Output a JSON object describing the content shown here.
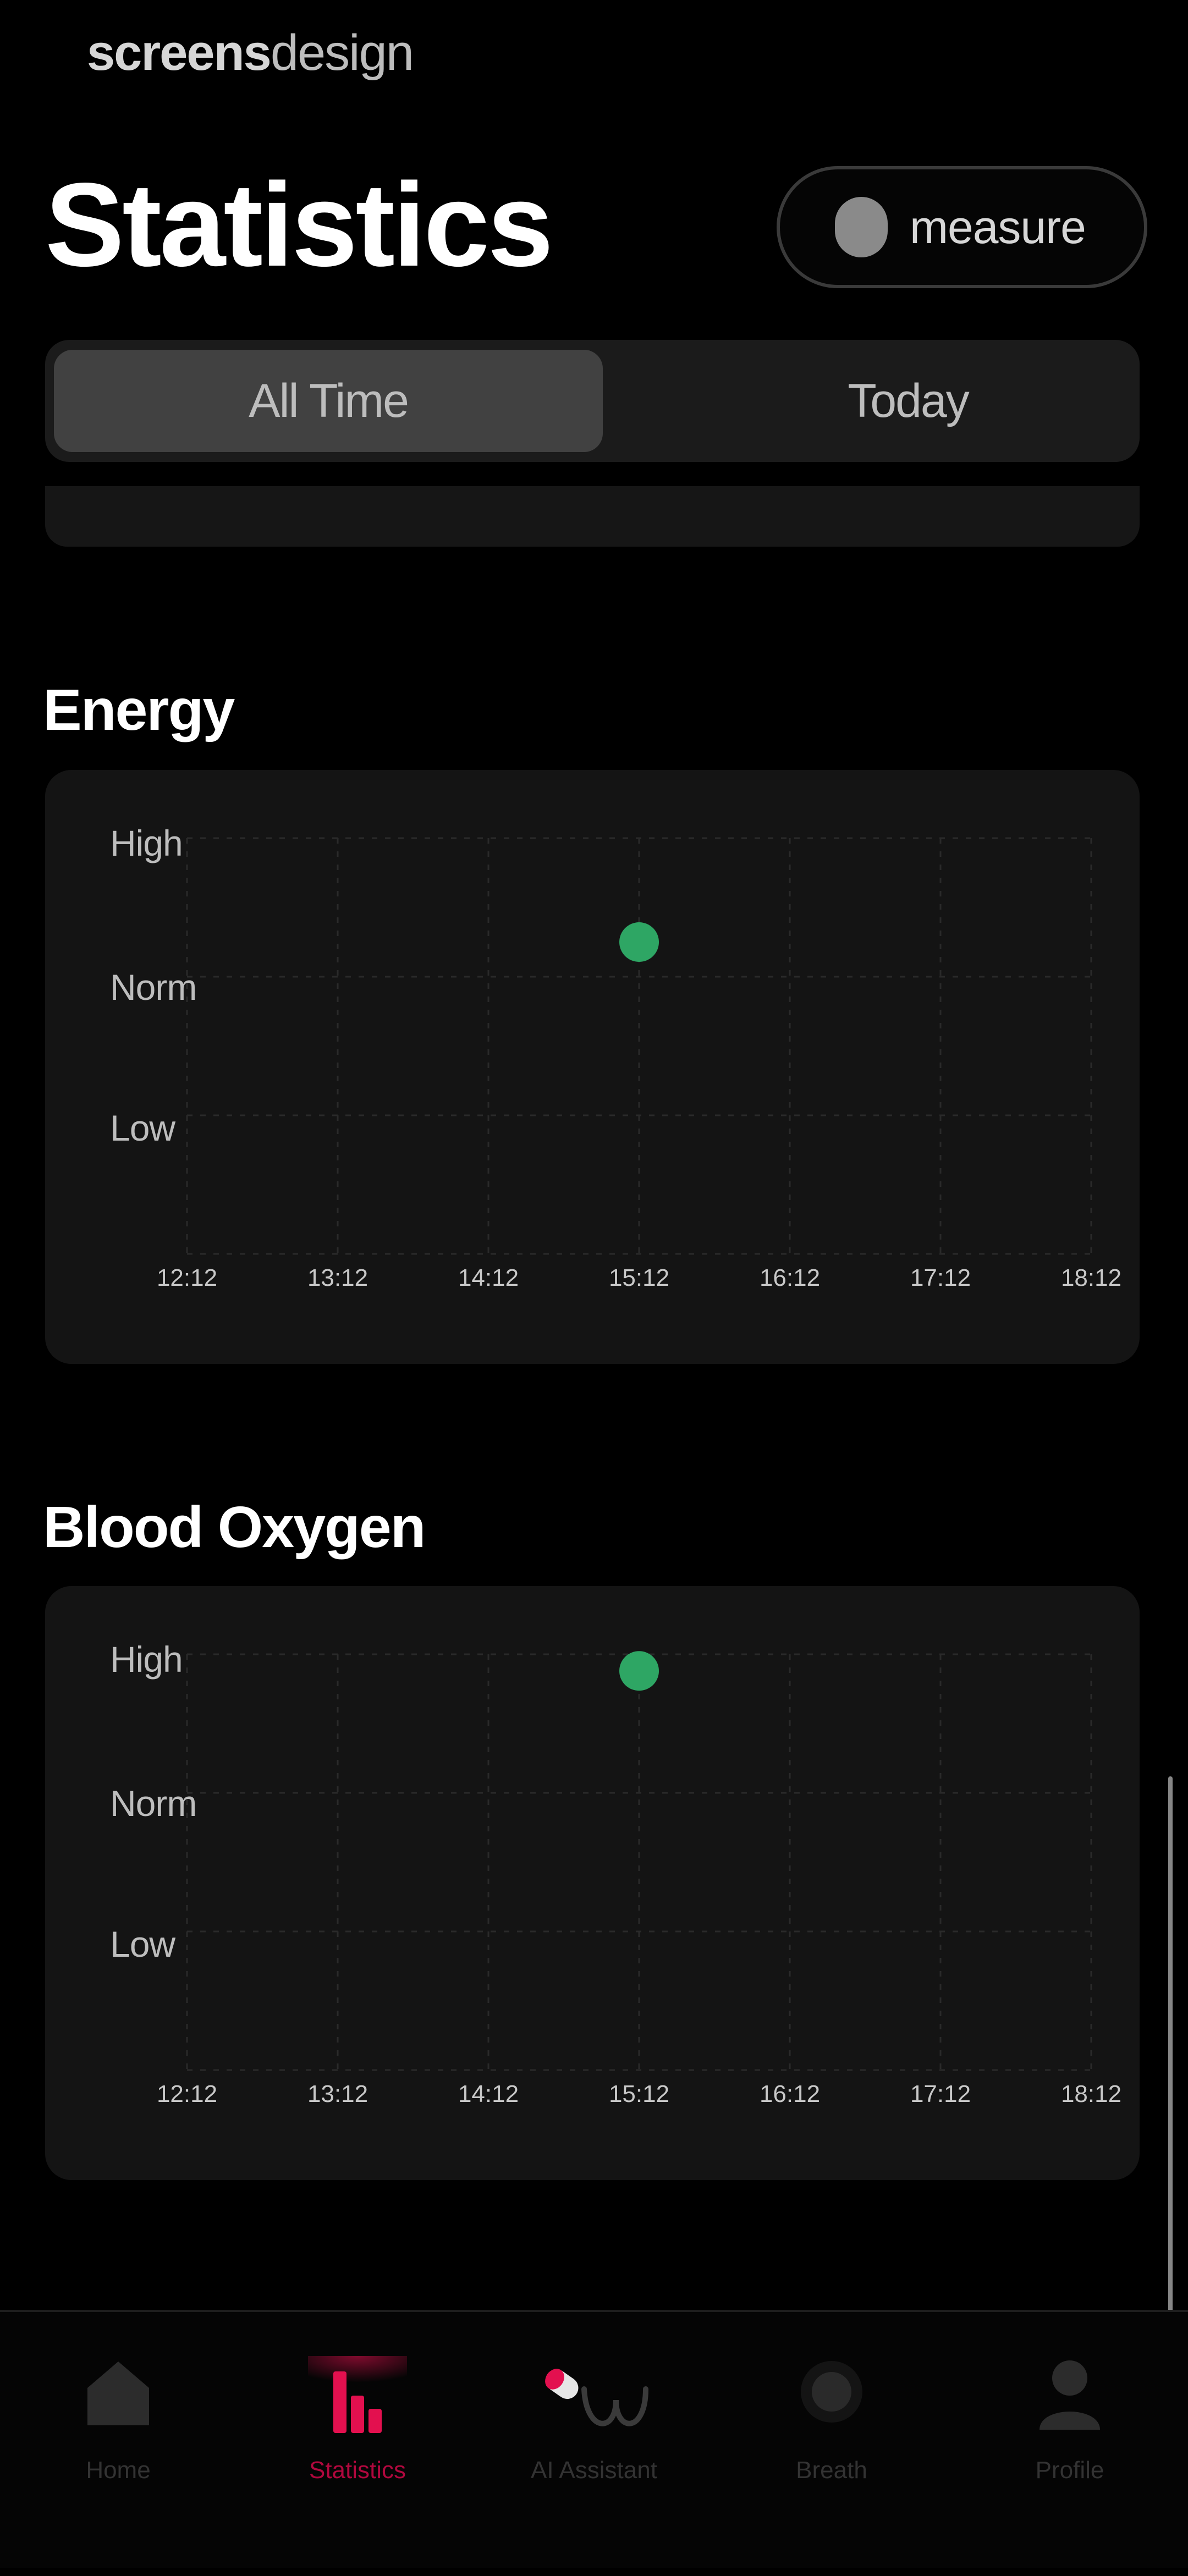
{
  "brand": {
    "part1": "screens",
    "part2": "design"
  },
  "header": {
    "title": "Statistics",
    "measure_label": "measure"
  },
  "segmented": {
    "items": [
      "All Time",
      "Today"
    ],
    "active": 0
  },
  "sections": [
    {
      "title": "Energy",
      "chart_data": {
        "type": "scatter",
        "title": "Energy",
        "y_categories": [
          "High",
          "Norm",
          "Low"
        ],
        "x_tick_labels": [
          "12:12",
          "13:12",
          "14:12",
          "15:12",
          "16:12",
          "17:12",
          "18:12"
        ],
        "points": [
          {
            "x": "15:12",
            "y": 0.75
          }
        ],
        "grid": true,
        "color": "#2ea664"
      }
    },
    {
      "title": "Blood Oxygen",
      "chart_data": {
        "type": "scatter",
        "title": "Blood Oxygen",
        "y_categories": [
          "High",
          "Norm",
          "Low"
        ],
        "x_tick_labels": [
          "12:12",
          "13:12",
          "14:12",
          "15:12",
          "16:12",
          "17:12",
          "18:12"
        ],
        "points": [
          {
            "x": "15:12",
            "y": 0.96
          }
        ],
        "grid": true,
        "color": "#2ea664"
      }
    }
  ],
  "tabbar": {
    "items": [
      {
        "label": "Home",
        "icon": "home-icon",
        "active": false
      },
      {
        "label": "Statistics",
        "icon": "bar-chart-icon",
        "active": true
      },
      {
        "label": "AI Assistant",
        "icon": "stethoscope-pill-icon",
        "active": false
      },
      {
        "label": "Breath",
        "icon": "breath-icon",
        "active": false
      },
      {
        "label": "Profile",
        "icon": "person-icon",
        "active": false
      }
    ]
  },
  "colors": {
    "background": "#000000",
    "card": "#141414",
    "accent": "#e3104f",
    "point": "#2ea664"
  }
}
